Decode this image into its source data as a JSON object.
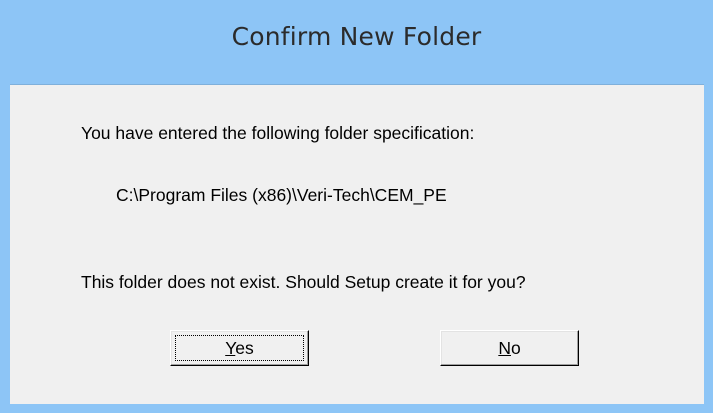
{
  "dialog": {
    "title": "Confirm New Folder",
    "message_line1": "You have entered the following folder specification:",
    "folder_path": "C:\\Program Files (x86)\\Veri-Tech\\CEM_PE",
    "message_line3": "This folder does not exist.  Should Setup create it for you?",
    "buttons": {
      "yes": {
        "mnemonic": "Y",
        "rest": "es",
        "focused": true
      },
      "no": {
        "mnemonic": "N",
        "rest": "o"
      }
    }
  },
  "colors": {
    "titlebar": "#8dc5f6",
    "client": "#f0f0f0",
    "text": "#000000"
  }
}
